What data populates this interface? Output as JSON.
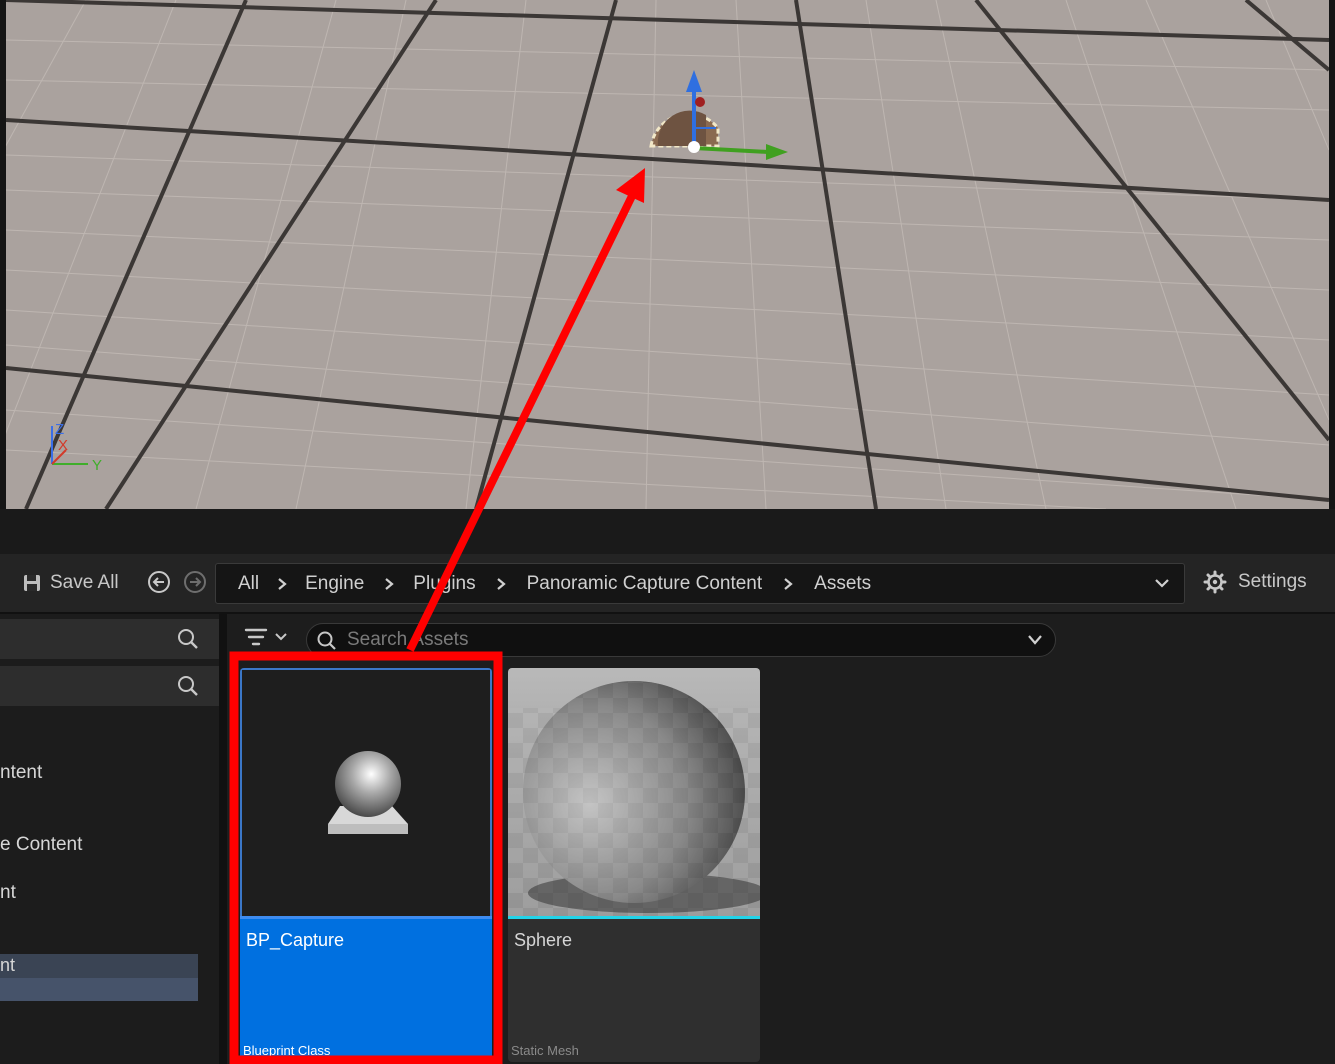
{
  "viewport": {
    "gizmo_labels": {
      "z": "Z",
      "x": "X",
      "y": "Y"
    }
  },
  "toolbar": {
    "save_all_label": "Save All",
    "back_icon": "back-arrow-icon",
    "forward_icon": "forward-arrow-icon",
    "settings_label": "Settings"
  },
  "breadcrumb": {
    "items": [
      "All",
      "Engine",
      "Plugins",
      "Panoramic Capture Content",
      "Assets"
    ]
  },
  "left_panel": {
    "items": [
      "ntent",
      "e Content",
      "nt",
      "nt"
    ]
  },
  "asset_search": {
    "placeholder": "Search Assets"
  },
  "assets": [
    {
      "name": "BP_Capture",
      "type": "Blueprint Class",
      "selected": true,
      "accent_color": "#3e8cf0"
    },
    {
      "name": "Sphere",
      "type": "Static Mesh",
      "selected": false,
      "accent_color": "#22d3e8"
    }
  ],
  "annotation": {
    "highlight_color": "#ff0000"
  }
}
